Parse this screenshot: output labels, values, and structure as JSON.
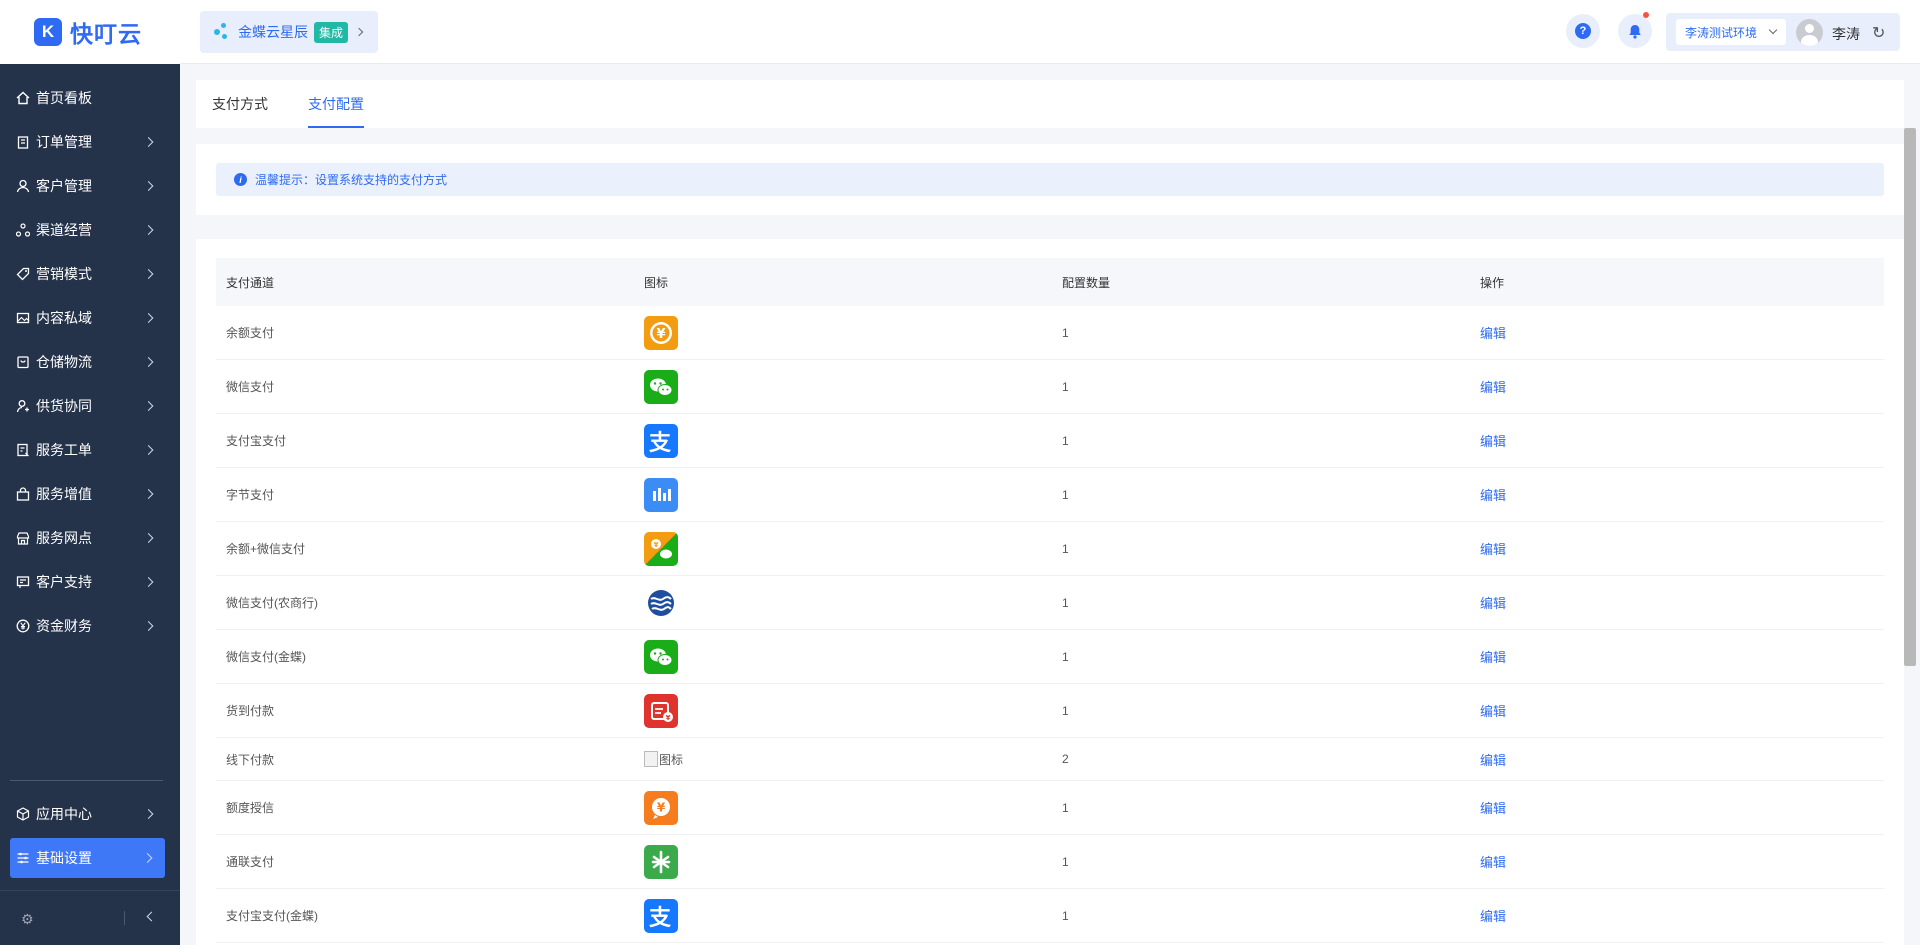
{
  "app": {
    "logo_mark": "K",
    "logo_text": "快叮云"
  },
  "header": {
    "brand_name": "金蝶云星辰",
    "brand_badge": "集成",
    "help_label": "?",
    "env_select": "李涛测试环境",
    "user_name": "李涛",
    "refresh_icon": "refresh-icon"
  },
  "sidebar": {
    "items": [
      {
        "label": "首页看板",
        "icon": "home-icon",
        "chevron": false
      },
      {
        "label": "订单管理",
        "icon": "clipboard-icon",
        "chevron": true
      },
      {
        "label": "客户管理",
        "icon": "user-icon",
        "chevron": true
      },
      {
        "label": "渠道经营",
        "icon": "share-icon",
        "chevron": true
      },
      {
        "label": "营销模式",
        "icon": "tag-icon",
        "chevron": true
      },
      {
        "label": "内容私域",
        "icon": "image-icon",
        "chevron": true
      },
      {
        "label": "仓储物流",
        "icon": "box-icon",
        "chevron": true
      },
      {
        "label": "供货协同",
        "icon": "user-link-icon",
        "chevron": true
      },
      {
        "label": "服务工单",
        "icon": "ticket-icon",
        "chevron": true
      },
      {
        "label": "服务增值",
        "icon": "bag-icon",
        "chevron": true
      },
      {
        "label": "服务网点",
        "icon": "store-icon",
        "chevron": true
      },
      {
        "label": "客户支持",
        "icon": "support-icon",
        "chevron": true
      },
      {
        "label": "资金财务",
        "icon": "yen-icon",
        "chevron": true
      }
    ],
    "bottom": [
      {
        "label": "应用中心",
        "icon": "cube-icon"
      },
      {
        "label": "基础设置",
        "icon": "sliders-icon"
      }
    ]
  },
  "tabs": [
    {
      "label": "支付方式",
      "active": false
    },
    {
      "label": "支付配置",
      "active": true
    }
  ],
  "tip": {
    "icon": "i",
    "text": "温馨提示：设置系统支持的支付方式"
  },
  "table": {
    "headers": [
      "支付通道",
      "图标",
      "配置数量",
      "操作"
    ],
    "rows": [
      {
        "channel": "余额支付",
        "icon": "balance-pay-icon",
        "icon_color": "#f39c12",
        "count": "1",
        "action": "编辑"
      },
      {
        "channel": "微信支付",
        "icon": "wechat-pay-icon",
        "icon_color": "#1aad19",
        "count": "1",
        "action": "编辑"
      },
      {
        "channel": "支付宝支付",
        "icon": "alipay-icon",
        "icon_color": "#1677ff",
        "count": "1",
        "action": "编辑"
      },
      {
        "channel": "字节支付",
        "icon": "bytedance-pay-icon",
        "icon_color": "#3c8cf6",
        "count": "1",
        "action": "编辑"
      },
      {
        "channel": "余额+微信支付",
        "icon": "balance-wechat-icon",
        "icon_color": "#f39c12",
        "count": "1",
        "action": "编辑"
      },
      {
        "channel": "微信支付(农商行)",
        "icon": "rural-bank-icon",
        "icon_color": "#1f4e9e",
        "count": "1",
        "action": "编辑"
      },
      {
        "channel": "微信支付(金蝶)",
        "icon": "wechat-pay-icon",
        "icon_color": "#1aad19",
        "count": "1",
        "action": "编辑"
      },
      {
        "channel": "货到付款",
        "icon": "cash-on-delivery-icon",
        "icon_color": "#e0332d",
        "count": "1",
        "action": "编辑"
      },
      {
        "channel": "线下付款",
        "icon": "broken-image-icon",
        "icon_alt": "图标",
        "count": "2",
        "action": "编辑"
      },
      {
        "channel": "额度授信",
        "icon": "credit-icon",
        "icon_color": "#f57c1f",
        "count": "1",
        "action": "编辑"
      },
      {
        "channel": "通联支付",
        "icon": "allinpay-icon",
        "icon_color": "#3aaa4a",
        "count": "1",
        "action": "编辑"
      },
      {
        "channel": "支付宝支付(金蝶)",
        "icon": "alipay-icon",
        "icon_color": "#1677ff",
        "count": "1",
        "action": "编辑"
      }
    ]
  }
}
